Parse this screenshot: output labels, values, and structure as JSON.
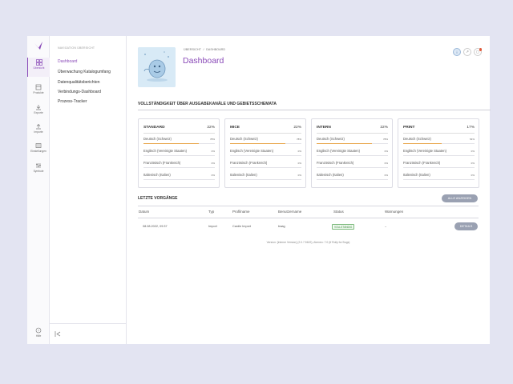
{
  "rail": {
    "items": [
      {
        "label": "Übersicht",
        "icon": "grid-icon",
        "active": true
      },
      {
        "label": "Produkte",
        "icon": "box-icon"
      },
      {
        "label": "Exporte",
        "icon": "download-icon"
      },
      {
        "label": "Importe",
        "icon": "upload-icon"
      },
      {
        "label": "Einstellungen",
        "icon": "settings-icon"
      },
      {
        "label": "Symbole",
        "icon": "sliders-icon"
      }
    ],
    "help_label": "Hilfe"
  },
  "nav": {
    "heading": "NAVIGATION ÜBERSICHT",
    "items": [
      {
        "label": "Dashboard",
        "active": true
      },
      {
        "label": "Überwachung Katalogumfang"
      },
      {
        "label": "Datenqualitätsberichten"
      },
      {
        "label": "Verbindungs-Dashboard"
      },
      {
        "label": "Prozess-Tracker"
      }
    ]
  },
  "header": {
    "breadcrumb_root": "ÜBERSICHT",
    "breadcrumb_sep": "/",
    "breadcrumb_current": "DASHBOARD",
    "title": "Dashboard"
  },
  "completeness": {
    "title": "VOLLSTÄNDIGKEIT ÜBER AUSGABEKANÄLE UND GEBIETSSCHEMATA",
    "cards": [
      {
        "name": "STANDARD",
        "pct": "22%",
        "langs": [
          {
            "name": "Deutsch (Schweiz)",
            "pct": "78%",
            "value": 78
          },
          {
            "name": "Englisch (Vereinigte Staaten)",
            "pct": "0%",
            "value": 0
          },
          {
            "name": "Französisch (Frankreich)",
            "pct": "0%",
            "value": 0
          },
          {
            "name": "Italienisch (Italien)",
            "pct": "0%",
            "value": 0
          }
        ]
      },
      {
        "name": "MICE",
        "pct": "22%",
        "langs": [
          {
            "name": "Deutsch (Schweiz)",
            "pct": "78%",
            "value": 78
          },
          {
            "name": "Englisch (Vereinigte Staaten)",
            "pct": "0%",
            "value": 0
          },
          {
            "name": "Französisch (Frankreich)",
            "pct": "0%",
            "value": 0
          },
          {
            "name": "Italienisch (Italien)",
            "pct": "0%",
            "value": 0
          }
        ]
      },
      {
        "name": "INTERN",
        "pct": "22%",
        "langs": [
          {
            "name": "Deutsch (Schweiz)",
            "pct": "78%",
            "value": 78
          },
          {
            "name": "Englisch (Vereinigte Staaten)",
            "pct": "0%",
            "value": 0
          },
          {
            "name": "Französisch (Frankreich)",
            "pct": "0%",
            "value": 0
          },
          {
            "name": "Italienisch (Italien)",
            "pct": "0%",
            "value": 0
          }
        ]
      },
      {
        "name": "PRINT",
        "pct": "17%",
        "langs": [
          {
            "name": "Deutsch (Schweiz)",
            "pct": "54%",
            "value": 54
          },
          {
            "name": "Englisch (Vereinigte Staaten)",
            "pct": "0%",
            "value": 0
          },
          {
            "name": "Französisch (Frankreich)",
            "pct": "0%",
            "value": 0
          },
          {
            "name": "Italienisch (Italien)",
            "pct": "0%",
            "value": 0
          }
        ]
      }
    ]
  },
  "recent": {
    "title": "LETZTE VORGÄNGE",
    "all_button": "ALLE ANZEIGEN",
    "columns": [
      "Datum",
      "Typ",
      "Profilname",
      "Benutzername",
      "Status",
      "Warnungen"
    ],
    "rows": [
      {
        "date": "08.08.2022, 09:37",
        "type": "Import",
        "profile": "Cardle Import",
        "user": "traag",
        "status": "VOLLSTÄNDIG",
        "warnings": "–",
        "action": "DETAILS"
      }
    ]
  },
  "footer": "Version: [interne Version] (2.0.7.5622), Akeneo: 7.0 (tf Rolly for Bugs)",
  "colors": {
    "accent": "#8a4bb8",
    "progress": "#e8a64a",
    "status_ok": "#3a8a3a"
  }
}
